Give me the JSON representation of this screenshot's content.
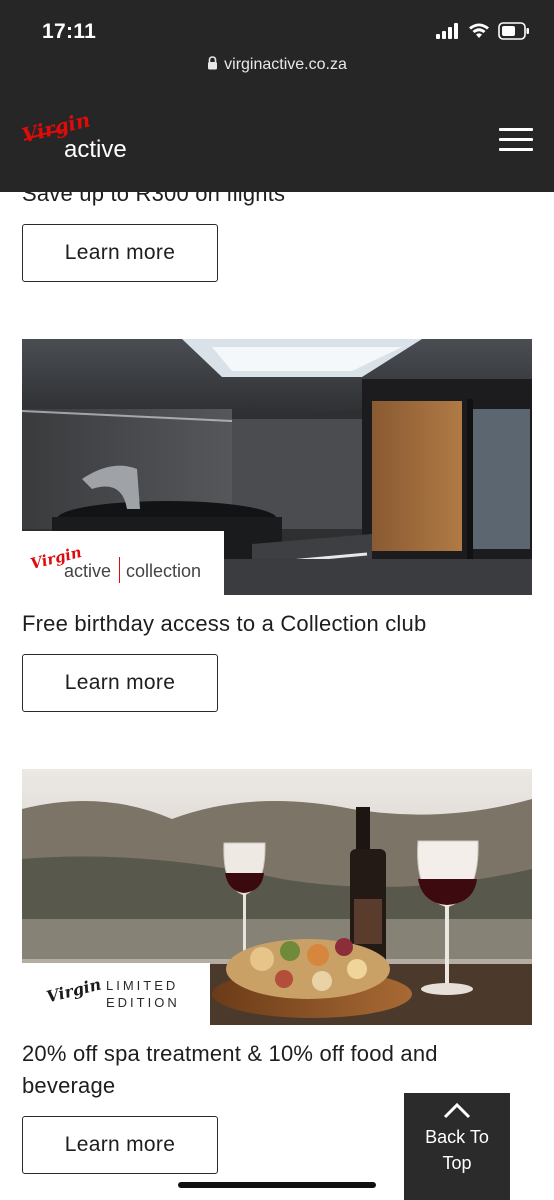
{
  "status_bar": {
    "time": "17:11"
  },
  "browser": {
    "url": "virginactive.co.za"
  },
  "header": {
    "menu_icon": "hamburger-icon"
  },
  "offers": [
    {
      "title": "Save up to R300 on flights",
      "button": "Learn more"
    },
    {
      "title": "Free birthday access to a Collection club",
      "button": "Learn more",
      "badge_brand": "Virgin",
      "badge_text_a": "active",
      "badge_text_b": "collection"
    },
    {
      "title_line1": "20% off spa treatment & 10% off food and",
      "title_line2": "beverage",
      "button": "Learn more",
      "badge_brand": "Virgin",
      "badge_text_a": "LIMITED",
      "badge_text_b": "EDITION"
    }
  ],
  "back_to_top": {
    "line1": "Back To",
    "line2": "Top"
  },
  "colors": {
    "brand_red": "#e10a0a",
    "header_bg": "#262626"
  }
}
